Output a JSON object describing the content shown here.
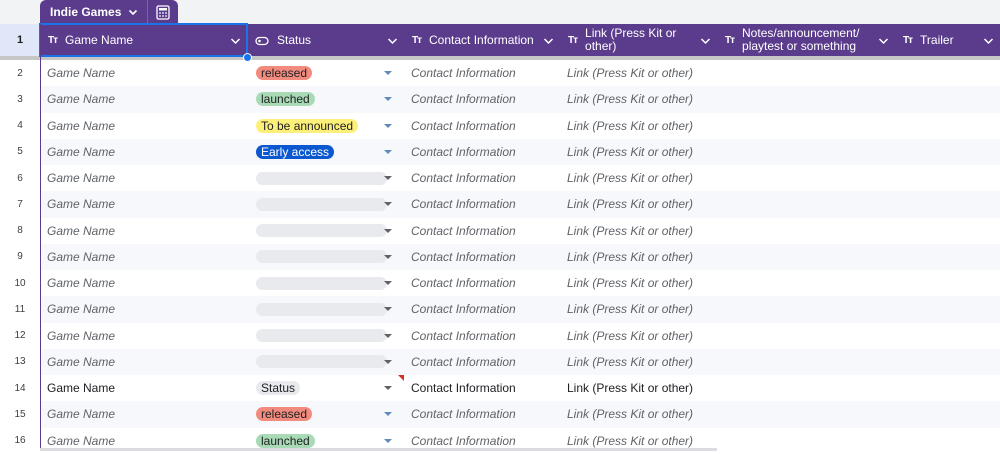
{
  "table_tab": {
    "name": "Indie Games"
  },
  "header": {
    "row_number": "1",
    "columns": [
      {
        "icon": "text-type-icon",
        "icon_glyph": "Tт",
        "label": "Game Name"
      },
      {
        "icon": "dropdown-chip-icon",
        "icon_glyph": "",
        "label": "Status"
      },
      {
        "icon": "text-type-icon",
        "icon_glyph": "Tт",
        "label": "Contact Information"
      },
      {
        "icon": "text-type-icon",
        "icon_glyph": "Tт",
        "label": "Link (Press Kit or other)"
      },
      {
        "icon": "text-type-icon",
        "icon_glyph": "Tт",
        "label": "Notes/announcement/ playtest or something"
      },
      {
        "icon": "text-type-icon",
        "icon_glyph": "Tт",
        "label": "Trailer"
      }
    ]
  },
  "status_colors": {
    "released": "#f28b7d",
    "launched": "#a8dab5",
    "To be announced": "#fdf07a",
    "Early access": "#0b57d0",
    "Status": "#e8eaed"
  },
  "rows": [
    {
      "num": "2",
      "game": "Game Name",
      "status": "released",
      "contact": "Contact Information",
      "link": "Link (Press Kit or other)",
      "style": "placeholder"
    },
    {
      "num": "3",
      "game": "Game Name",
      "status": "launched",
      "contact": "Contact Information",
      "link": "Link (Press Kit or other)",
      "style": "placeholder"
    },
    {
      "num": "4",
      "game": "Game Name",
      "status": "To be announced",
      "contact": "Contact Information",
      "link": "Link (Press Kit or other)",
      "style": "placeholder"
    },
    {
      "num": "5",
      "game": "Game Name",
      "status": "Early access",
      "contact": "Contact Information",
      "link": "Link (Press Kit or other)",
      "style": "placeholder"
    },
    {
      "num": "6",
      "game": "Game Name",
      "status": "",
      "contact": "Contact Information",
      "link": "Link (Press Kit or other)",
      "style": "placeholder"
    },
    {
      "num": "7",
      "game": "Game Name",
      "status": "",
      "contact": "Contact Information",
      "link": "Link (Press Kit or other)",
      "style": "placeholder"
    },
    {
      "num": "8",
      "game": "Game Name",
      "status": "",
      "contact": "Contact Information",
      "link": "Link (Press Kit or other)",
      "style": "placeholder"
    },
    {
      "num": "9",
      "game": "Game Name",
      "status": "",
      "contact": "Contact Information",
      "link": "Link (Press Kit or other)",
      "style": "placeholder"
    },
    {
      "num": "10",
      "game": "Game Name",
      "status": "",
      "contact": "Contact Information",
      "link": "Link (Press Kit or other)",
      "style": "placeholder"
    },
    {
      "num": "11",
      "game": "Game Name",
      "status": "",
      "contact": "Contact Information",
      "link": "Link (Press Kit or other)",
      "style": "placeholder"
    },
    {
      "num": "12",
      "game": "Game Name",
      "status": "",
      "contact": "Contact Information",
      "link": "Link (Press Kit or other)",
      "style": "placeholder"
    },
    {
      "num": "13",
      "game": "Game Name",
      "status": "",
      "contact": "Contact Information",
      "link": "Link (Press Kit or other)",
      "style": "placeholder"
    },
    {
      "num": "14",
      "game": "Game Name",
      "status": "Status",
      "contact": "Contact Information",
      "link": "Link (Press Kit or other)",
      "style": "filled"
    },
    {
      "num": "15",
      "game": "Game Name",
      "status": "released",
      "contact": "Contact Information",
      "link": "Link (Press Kit or other)",
      "style": "placeholder"
    },
    {
      "num": "16",
      "game": "Game Name",
      "status": "launched",
      "contact": "Contact Information",
      "link": "Link (Press Kit or other)",
      "style": "placeholder"
    }
  ]
}
